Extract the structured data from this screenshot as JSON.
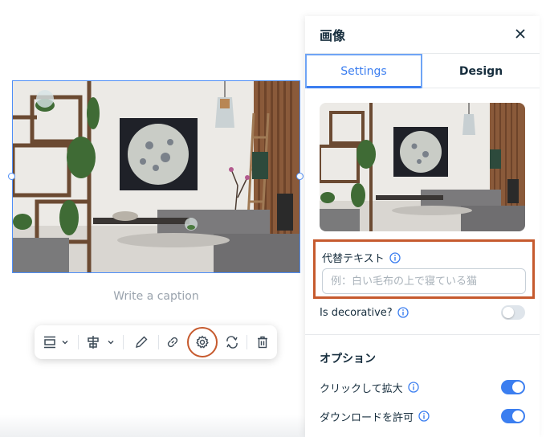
{
  "canvas": {
    "caption_placeholder": "Write a caption",
    "toolbar": {
      "items": [
        "align-icon",
        "chevron-down-icon",
        "layout-icon",
        "chevron-down-icon",
        "pencil-icon",
        "link-icon",
        "gear-icon",
        "replace-icon",
        "trash-icon"
      ],
      "highlighted": "gear-icon"
    }
  },
  "panel": {
    "title": "画像",
    "tabs": [
      {
        "label": "Settings",
        "active": true
      },
      {
        "label": "Design",
        "active": false
      }
    ],
    "alt_text": {
      "label": "代替テキスト",
      "placeholder": "例：白い毛布の上で寝ている猫",
      "value": ""
    },
    "decorative": {
      "label": "Is decorative?",
      "on": false
    },
    "options": {
      "title": "オプション",
      "items": [
        {
          "label": "クリックして拡大",
          "on": true
        },
        {
          "label": "ダウンロードを許可",
          "on": true
        }
      ]
    }
  },
  "colors": {
    "accent": "#3b7ef0",
    "highlight": "#c65a2e",
    "selection": "#4f8ff7",
    "text": "#162d3d",
    "muted": "#9aa3ad"
  }
}
